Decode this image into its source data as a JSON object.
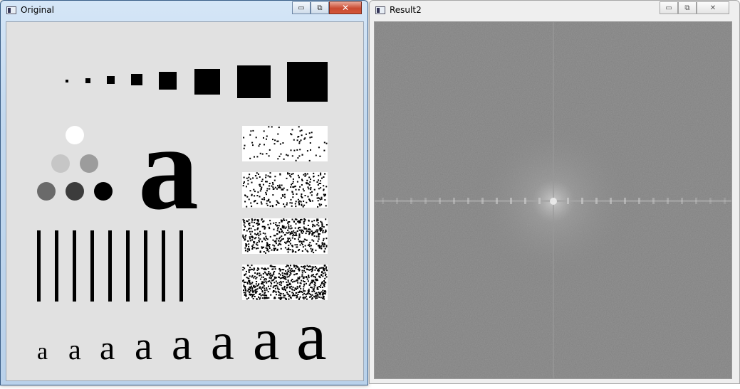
{
  "windows": {
    "original": {
      "title": "Original",
      "controls": {
        "minimize": "▭",
        "maximize": "⧉",
        "close": "✕"
      }
    },
    "result": {
      "title": "Result2",
      "controls": {
        "minimize": "▭",
        "maximize": "⧉",
        "close": "✕"
      }
    }
  },
  "test_pattern": {
    "squares": 8,
    "circle_grays": [
      "#ffffff",
      "#c6c6c6",
      "#9c9c9c",
      "#6a6a6a",
      "#3c3c3c",
      "#000000"
    ],
    "big_letter": "a",
    "noise_densities": [
      0.1,
      0.3,
      0.55,
      0.75
    ],
    "bars": 9,
    "letters": [
      "a",
      "a",
      "a",
      "a",
      "a",
      "a",
      "a",
      "a"
    ]
  },
  "spectrum": {
    "background_gray": "#808080",
    "center_highlight": "#b0b0b0"
  }
}
